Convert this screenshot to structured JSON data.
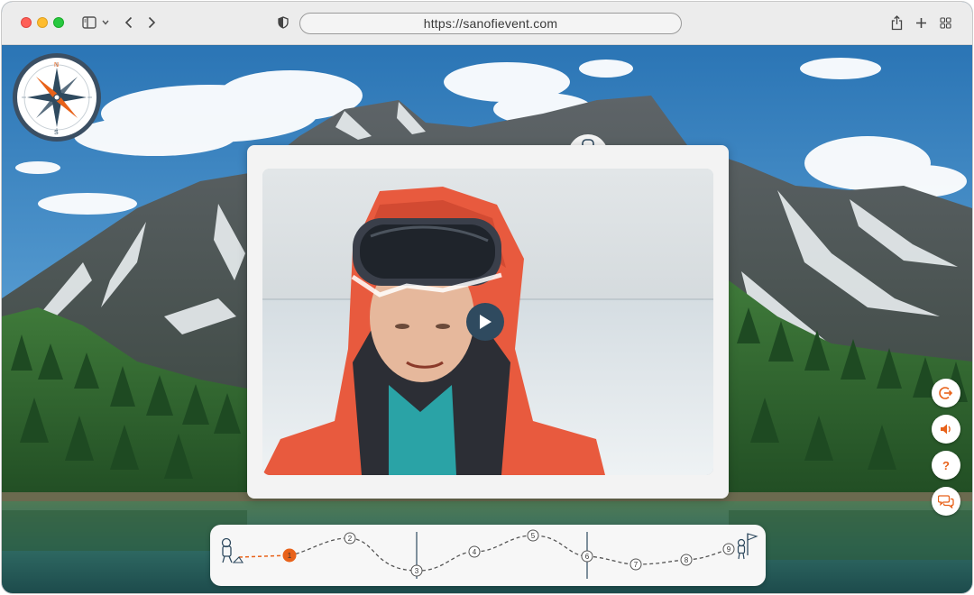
{
  "browser": {
    "url": "https://sanofievent.com",
    "icons": [
      "sidebar-icon",
      "chevron-down-icon",
      "back-icon",
      "forward-icon",
      "shield-icon",
      "share-icon",
      "new-tab-icon",
      "tab-overview-icon"
    ]
  },
  "compass": {
    "north": "N",
    "south": "S"
  },
  "video": {
    "play_icon": "play-icon"
  },
  "side_buttons": [
    {
      "name": "exit-button",
      "icon": "exit-icon"
    },
    {
      "name": "sound-button",
      "icon": "speaker-icon"
    },
    {
      "name": "help-button",
      "icon": "question-icon",
      "label": "?"
    },
    {
      "name": "chat-button",
      "icon": "chat-icon"
    }
  ],
  "journey": {
    "start_icon": "hiker-icon",
    "end_icon": "summit-flag-icon",
    "current_step": "1",
    "steps": [
      "1",
      "2",
      "3",
      "4",
      "5",
      "6",
      "7",
      "8",
      "9"
    ]
  },
  "colors": {
    "accent": "#e8621a",
    "chrome": "#ececec",
    "navy": "#2f4a5f"
  }
}
